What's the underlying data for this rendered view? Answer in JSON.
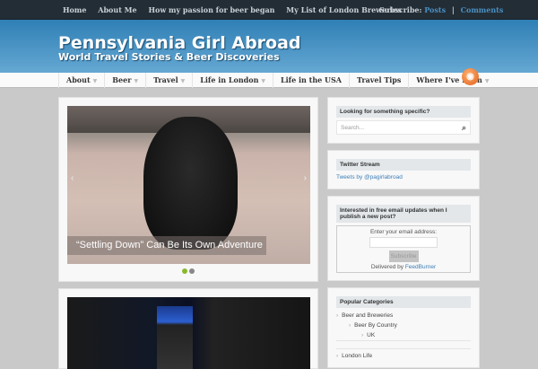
{
  "topbar": {
    "links": [
      "Home",
      "About Me",
      "How my passion for beer began",
      "My List of London Breweries"
    ],
    "subscribe_label": "Subscribe:",
    "posts": "Posts",
    "sep": "|",
    "comments": "Comments"
  },
  "header": {
    "title": "Pennsylvania Girl Abroad",
    "tagline": "World Travel Stories & Beer Discoveries"
  },
  "nav": {
    "items": [
      "About",
      "Beer",
      "Travel",
      "Life in London",
      "Life in the USA",
      "Travel Tips",
      "Where I've Been"
    ],
    "rss_icon": "rss-icon"
  },
  "slider": {
    "caption": "“Settling Down” Can Be Its Own Adventure",
    "prev": "‹",
    "next": "›",
    "slide_count": 2,
    "active_slide": 1
  },
  "sidebar": {
    "search": {
      "title": "Looking for something specific?",
      "placeholder": "Search...",
      "icon": "⌕"
    },
    "twitter": {
      "title": "Twitter Stream",
      "link": "Tweets by @pagirlabroad"
    },
    "email": {
      "title": "Interested in free email updates when I publish a new post?",
      "label": "Enter your email address:",
      "button": "Subscribe",
      "delivered": "Delivered by",
      "feedburner": "FeedBurner"
    },
    "categories": {
      "title": "Popular Categories",
      "items": [
        "Beer and Breweries",
        "Beer By Country",
        "UK",
        "London Life"
      ]
    }
  }
}
